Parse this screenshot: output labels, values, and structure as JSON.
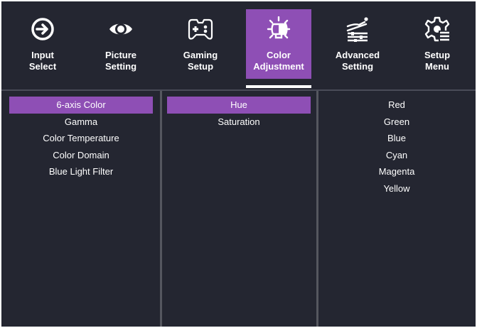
{
  "tabs": [
    {
      "label": "Input\nSelect",
      "icon": "input-select-icon",
      "active": false
    },
    {
      "label": "Picture\nSetting",
      "icon": "eye-icon",
      "active": false
    },
    {
      "label": "Gaming\nSetup",
      "icon": "gamepad-icon",
      "active": false
    },
    {
      "label": "Color\nAdjustment",
      "icon": "color-adjust-icon",
      "active": true
    },
    {
      "label": "Advanced\nSetting",
      "icon": "advanced-icon",
      "active": false
    },
    {
      "label": "Setup\nMenu",
      "icon": "gear-icon",
      "active": false
    }
  ],
  "columns": {
    "menu": {
      "items": [
        "6-axis Color",
        "Gamma",
        "Color Temperature",
        "Color Domain",
        "Blue Light Filter"
      ],
      "selected": "6-axis Color"
    },
    "submenu": {
      "items": [
        "Hue",
        "Saturation"
      ],
      "selected": "Hue"
    },
    "options": {
      "items": [
        "Red",
        "Green",
        "Blue",
        "Cyan",
        "Magenta",
        "Yellow"
      ]
    }
  },
  "colors": {
    "background": "#242631",
    "accent": "#8e4fb5",
    "text": "#ffffff"
  }
}
